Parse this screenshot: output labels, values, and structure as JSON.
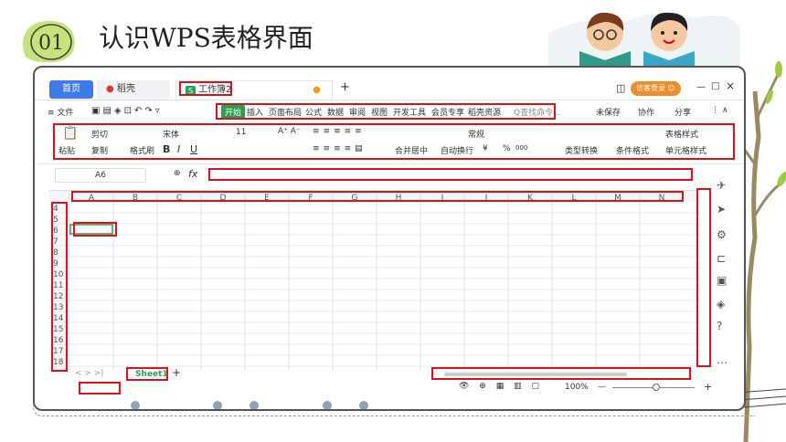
{
  "slide": {
    "number": "01",
    "title": "认识WPS表格界面"
  },
  "window": {
    "tabs": {
      "home": "首页",
      "docer": "稻壳",
      "doc": "工作簿2",
      "add": "+"
    },
    "visitor": "访客登录",
    "controls": [
      "—",
      "□",
      "×"
    ]
  },
  "menubar": {
    "file": "≡ 文件",
    "start": "开始",
    "items": [
      "插入",
      "页面布局",
      "公式",
      "数据",
      "审阅",
      "视图",
      "开发工具",
      "会员专享",
      "稻壳资源"
    ],
    "search": "Q查找命令...",
    "right": [
      "未保存",
      "协作",
      "分享"
    ]
  },
  "ribbon": {
    "paste": "粘贴",
    "cut": "剪切",
    "copy": "复制",
    "format_painter": "格式刷",
    "font_name": "宋体",
    "font_size": "11",
    "bold": "B",
    "italic": "I",
    "underline": "U",
    "merge": "合并居中",
    "wrap": "自动换行",
    "number_format": "常规",
    "currency": "¥",
    "percent": "%",
    "thousands": "000",
    "type_convert": "类型转换",
    "cond_format": "条件格式",
    "table_style": "表格样式",
    "cell_style": "单元格样式"
  },
  "formula_bar": {
    "name_box": "A6",
    "fx": "fx"
  },
  "grid": {
    "columns": [
      "A",
      "B",
      "C",
      "D",
      "E",
      "F",
      "G",
      "H",
      "I",
      "J",
      "K",
      "L",
      "M",
      "N"
    ],
    "rows": [
      "4",
      "5",
      "6",
      "7",
      "8",
      "9",
      "10",
      "11",
      "12",
      "13",
      "14",
      "15",
      "16",
      "17",
      "18"
    ]
  },
  "sheets": {
    "nav": "< > >|",
    "active": "Sheet1",
    "add": "+"
  },
  "status": {
    "zoom": "100%",
    "minus": "—",
    "plus": "+"
  },
  "colors": {
    "accent_green": "#2d9d4f",
    "accent_blue": "#3f7ae8",
    "highlight_red": "#e0101a",
    "visitor_orange": "#f08c2a"
  }
}
